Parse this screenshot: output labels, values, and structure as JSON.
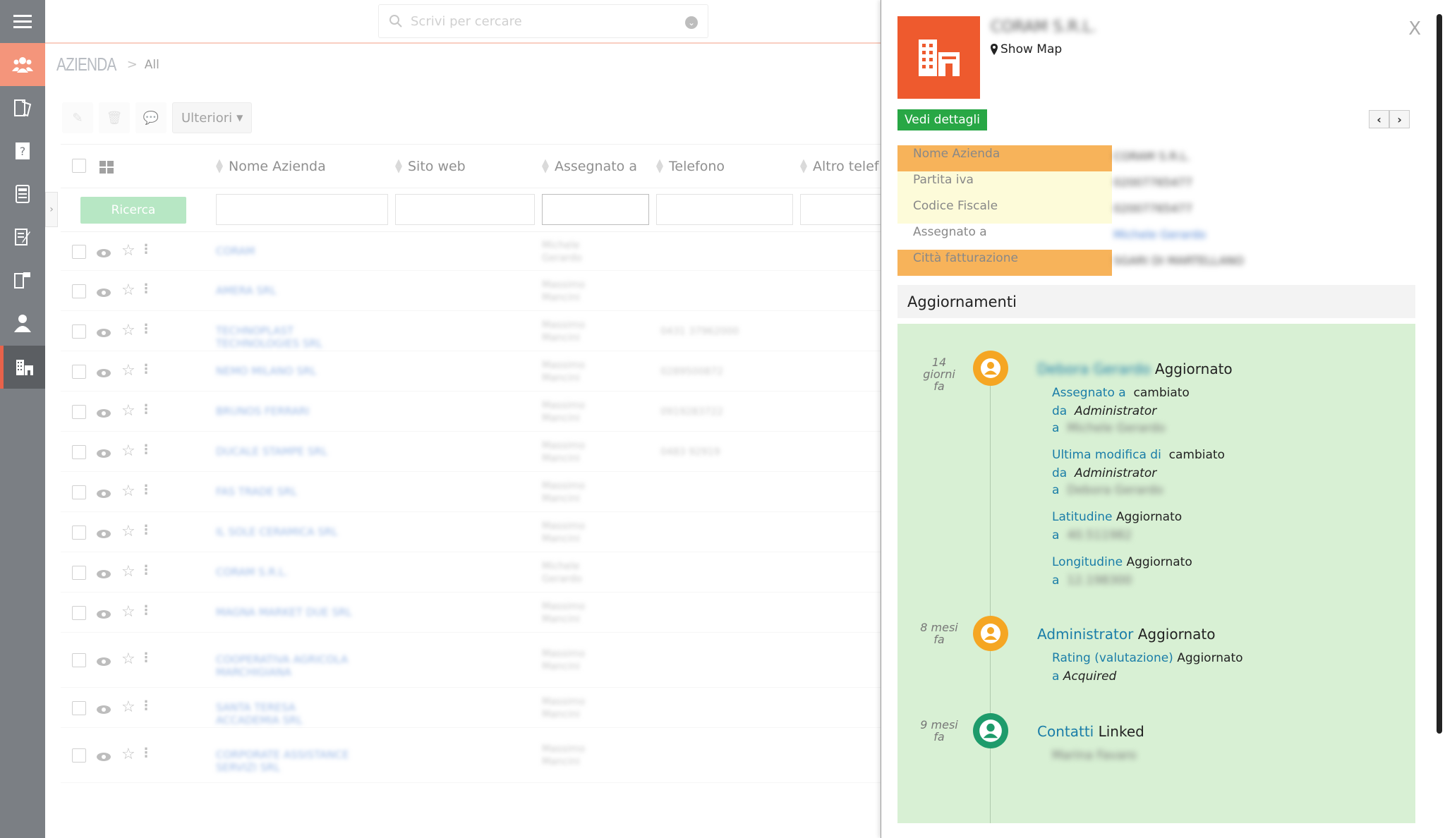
{
  "search": {
    "placeholder": "Scrivi per cercare"
  },
  "breadcrumb": {
    "module": "AZIENDA",
    "separator": ">",
    "view": "All"
  },
  "toolbar": {
    "more_label": "Ulteriori"
  },
  "table": {
    "columns": [
      "Nome Azienda",
      "Sito web",
      "Assegnato a",
      "Telefono",
      "Altro telef"
    ],
    "search_button": "Ricerca",
    "rows": [
      {
        "name": "CORAM",
        "assigned": "Michele Gerardo",
        "phone": ""
      },
      {
        "name": "AMERA SRL",
        "assigned": "Massimo Mancini",
        "phone": ""
      },
      {
        "name": "TECHNOPLAST TECHNOLOGIES SRL",
        "assigned": "Massimo Mancini",
        "phone": "0431 37962000"
      },
      {
        "name": "NEMO MILANO SRL",
        "assigned": "Massimo Mancini",
        "phone": "0289500872"
      },
      {
        "name": "BRUNOS FERRARI",
        "assigned": "Massimo Mancini",
        "phone": "0919283722"
      },
      {
        "name": "DUCALE STAMPE SRL",
        "assigned": "Massimo Mancini",
        "phone": "0483 92919"
      },
      {
        "name": "FAS TRADE SRL",
        "assigned": "Massimo Mancini",
        "phone": ""
      },
      {
        "name": "IL SOLE CERAMICA SRL",
        "assigned": "Massimo Mancini",
        "phone": ""
      },
      {
        "name": "CORAM S.R.L.",
        "assigned": "Michele Gerardo",
        "phone": ""
      },
      {
        "name": "MAGNA MARKET DUE SRL",
        "assigned": "Massimo Mancini",
        "phone": ""
      },
      {
        "name": "COOPERATIVA AGRICOLA MARCHIGIANA",
        "assigned": "Massimo Mancini",
        "phone": ""
      },
      {
        "name": "SANTA TERESA ACCADEMIA SRL",
        "assigned": "Massimo Mancini",
        "phone": ""
      },
      {
        "name": "CORPORATE ASSISTANCE SERVIZI SRL",
        "assigned": "Massimo Mancini",
        "phone": ""
      }
    ]
  },
  "panel": {
    "company_name": "CORAM S.R.L.",
    "show_map": "Show Map",
    "close": "X",
    "details_button": "Vedi dettagli",
    "fields": [
      {
        "label": "Nome Azienda",
        "value": "CORAM S.R.L.",
        "highlight": "orange"
      },
      {
        "label": "Partita iva",
        "value": "02007765477",
        "highlight": "yellow"
      },
      {
        "label": "Codice Fiscale",
        "value": "02007765477",
        "highlight": "yellow"
      },
      {
        "label": "Assegnato a",
        "value": "Michele Gerardo",
        "highlight": "none"
      },
      {
        "label": "Città fatturazione",
        "value": "SGARI DI MARTELLANO",
        "highlight": "orange"
      }
    ],
    "updates_title": "Aggiornamenti",
    "timeline": [
      {
        "when": [
          "14",
          "giorni",
          "fa"
        ],
        "who": "Debora Gerardo",
        "action": "Aggiornato",
        "lines": [
          {
            "key": "Assegnato a",
            "verb": "cambiato",
            "from_label": "da",
            "from": "Administrator",
            "to_label": "a",
            "to": "Michele Gerardo"
          },
          {
            "key": "Ultima modifica di",
            "verb": "cambiato",
            "from_label": "da",
            "from": "Administrator",
            "to_label": "a",
            "to": "Debora Gerardo"
          },
          {
            "key": "Latitudine",
            "verb": "Aggiornato",
            "to_label": "a",
            "to": "40.511982"
          },
          {
            "key": "Longitudine",
            "verb": "Aggiornato",
            "to_label": "a",
            "to": "12.198300"
          }
        ]
      },
      {
        "when": [
          "8 mesi",
          "fa"
        ],
        "who": "Administrator",
        "action": "Aggiornato",
        "lines": [
          {
            "key": "Rating (valutazione)",
            "verb": "Aggiornato",
            "to_label": "a",
            "to": "Acquired"
          }
        ]
      },
      {
        "when": [
          "9 mesi",
          "fa"
        ],
        "who": "Contatti",
        "action": "Linked",
        "linked": "Marina Favaro"
      }
    ]
  },
  "colors": {
    "sidebar": "#7b7f84",
    "brand_orange": "#ee5a2e",
    "success_green": "#28a745",
    "link_blue": "#1a7da8",
    "timeline_bg": "#d8f0d4"
  }
}
